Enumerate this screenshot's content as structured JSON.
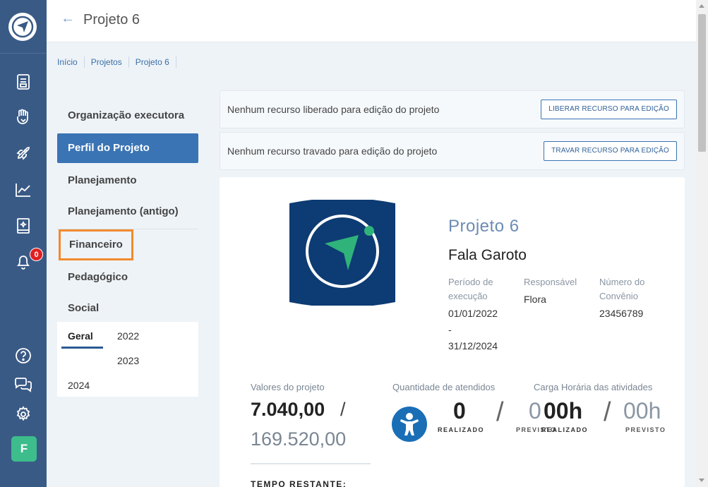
{
  "header": {
    "back_icon": "arrow-left-icon",
    "title": "Projeto 6"
  },
  "rail": {
    "icons": [
      "document-icon",
      "hand-heart-icon",
      "rocket-icon",
      "chart-line-icon",
      "book-sparkle-icon",
      "bell-icon",
      "help-icon",
      "chat-icon",
      "gear-icon"
    ],
    "notification_count": "0",
    "avatar_initial": "F",
    "colors": {
      "rail_bg": "#3a5a86",
      "avatar_bg": "#3dbc8c",
      "badge_bg": "#e02020"
    }
  },
  "breadcrumb": [
    "Início",
    "Projetos",
    "Projeto 6"
  ],
  "menu": {
    "items": [
      "Organização executora",
      "Perfil do Projeto",
      "Planejamento",
      "Planejamento (antigo)",
      "Financeiro",
      "Pedagógico",
      "Social"
    ],
    "active": "Perfil do Projeto",
    "highlighted": "Financeiro",
    "years": {
      "tab_geral": "Geral",
      "y2022": "2022",
      "y2023": "2023",
      "y2024": "2024"
    }
  },
  "resources": {
    "unlocked_text": "Nenhum recurso liberado para edição do projeto",
    "unlock_button": "LIBERAR RECURSO PARA EDIÇÃO",
    "locked_text": "Nenhum recurso travado para edição do projeto",
    "lock_button": "TRAVAR RECURSO PARA EDIÇÃO"
  },
  "project": {
    "name": "Projeto 6",
    "subtitle": "Fala Garoto",
    "periodo_label": "Período de execução",
    "periodo_start": "01/01/2022",
    "periodo_dash": "-",
    "periodo_end": "31/12/2024",
    "responsavel_label": "Responsável",
    "responsavel": "Flora",
    "convenio_label": "Número do Convênio",
    "convenio": "23456789"
  },
  "stats": {
    "valores_label": "Valores do projeto",
    "valor_realizado": "7.040,00",
    "slash": "/",
    "valor_total": "169.520,00",
    "atendidos_label": "Quantidade de atendidos",
    "atendidos_realizado": "0",
    "atendidos_previsto": "0",
    "carga_label": "Carga Horária das atividades",
    "carga_realizado": "00h",
    "carga_previsto": "00h",
    "realizado_label": "REALIZADO",
    "previsto_label": "PREVISTO",
    "tempo_label": "TEMPO RESTANTE:"
  }
}
